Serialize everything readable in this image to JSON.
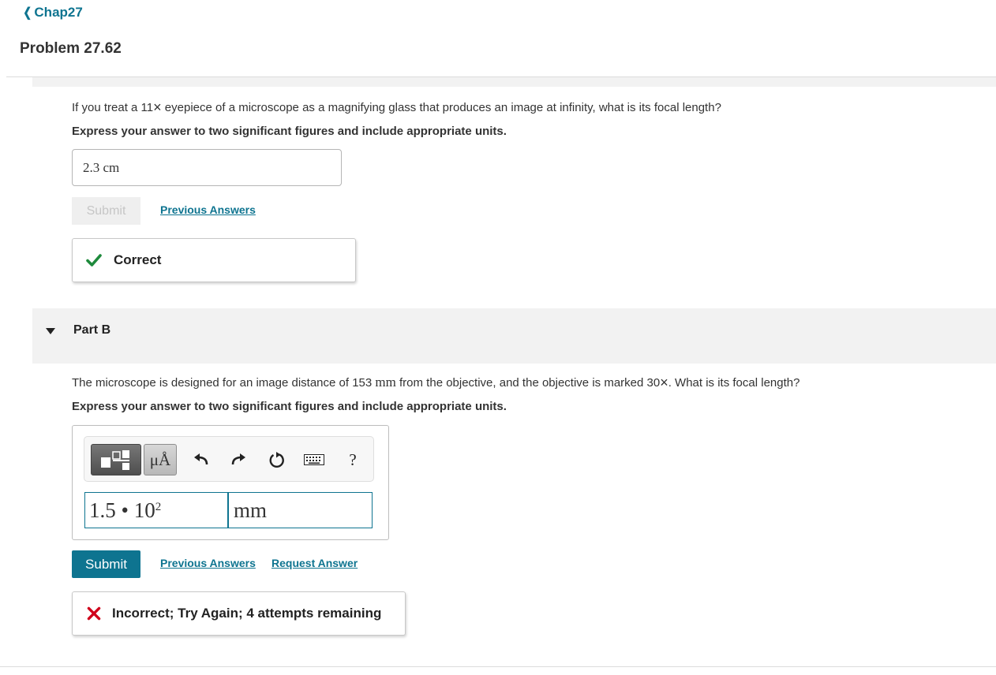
{
  "nav": {
    "back_label": "Chap27"
  },
  "problem": {
    "title": "Problem 27.62"
  },
  "part_a": {
    "question_pre": "If you treat a 11",
    "question_times": "×",
    "question_post": " eyepiece of a microscope as a magnifying glass that produces an image at infinity, what is its focal length?",
    "instruction": "Express your answer to two significant figures and include appropriate units.",
    "answer_value": "2.3 cm",
    "submit_label": "Submit",
    "previous_answers_label": "Previous Answers",
    "feedback": {
      "status": "correct",
      "text": "Correct",
      "icon": "check-icon",
      "color": "#1e8a3c"
    }
  },
  "part_b": {
    "label": "Part B",
    "question_pre": "The microscope is designed for an image distance of 153 ",
    "question_unit": "mm",
    "question_mid": " from the objective, and the objective is marked 30",
    "question_times": "×",
    "question_post": ". What is its focal length?",
    "instruction": "Express your answer to two significant figures and include appropriate units.",
    "toolbar": {
      "units_label": "μÅ",
      "help_label": "?",
      "icons": [
        "templates-icon",
        "units-icon",
        "undo-icon",
        "redo-icon",
        "reset-icon",
        "keyboard-icon",
        "help-icon"
      ]
    },
    "value_mantissa": "1.5 • 10",
    "value_exponent": "2",
    "unit_value": "mm",
    "submit_label": "Submit",
    "previous_answers_label": "Previous Answers",
    "request_answer_label": "Request Answer",
    "feedback": {
      "status": "incorrect",
      "text": "Incorrect; Try Again; 4 attempts remaining",
      "icon": "x-icon",
      "color": "#d0021b"
    }
  },
  "colors": {
    "accent": "#0e7490",
    "correct": "#1e8a3c",
    "incorrect": "#d0021b"
  }
}
